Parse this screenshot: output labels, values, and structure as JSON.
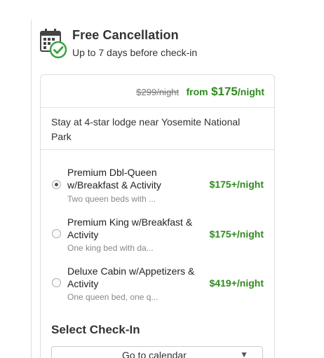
{
  "cancellation": {
    "icon": "calendar-check-icon",
    "title": "Free Cancellation",
    "subtitle": "Up to 7 days before check-in"
  },
  "pricing": {
    "original_price": "$299/night",
    "from_label": "from",
    "price": "$175",
    "per_night": "/night"
  },
  "description": "Stay at 4-star lodge near Yosemite National Park",
  "options": [
    {
      "name": "Premium Dbl-Queen w/Breakfast & Activity",
      "detail": "Two queen beds with ...",
      "price": "$175+/night",
      "selected": true
    },
    {
      "name": "Premium King w/Breakfast & Activity",
      "detail": "One king bed with da...",
      "price": "$175+/night",
      "selected": false
    },
    {
      "name": "Deluxe Cabin w/Appetizers & Activity",
      "detail": "One queen bed, one q...",
      "price": "$419+/night",
      "selected": false
    }
  ],
  "checkin": {
    "title": "Select Check-In",
    "button_label": "Go to calendar",
    "button_icon": "chevron-down-icon"
  },
  "colors": {
    "price_green": "#2f8a1f",
    "check_green": "#3aa33f",
    "text": "#333333"
  }
}
